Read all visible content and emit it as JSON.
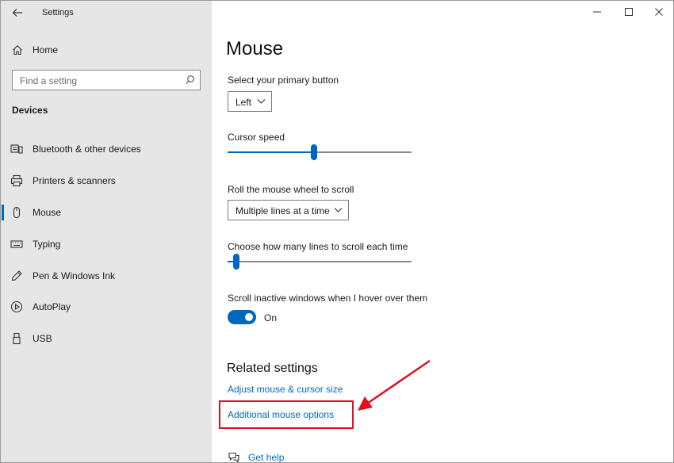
{
  "window": {
    "title": "Settings",
    "controls": [
      "minimize-icon",
      "maximize-icon",
      "close-icon"
    ]
  },
  "sidebar": {
    "home_label": "Home",
    "search_placeholder": "Find a setting",
    "section_title": "Devices",
    "items": [
      {
        "label": "Bluetooth & other devices",
        "icon": "bluetooth-device-icon",
        "selected": false
      },
      {
        "label": "Printers & scanners",
        "icon": "printer-icon",
        "selected": false
      },
      {
        "label": "Mouse",
        "icon": "mouse-icon",
        "selected": true
      },
      {
        "label": "Typing",
        "icon": "keyboard-icon",
        "selected": false
      },
      {
        "label": "Pen & Windows Ink",
        "icon": "pen-icon",
        "selected": false
      },
      {
        "label": "AutoPlay",
        "icon": "autoplay-icon",
        "selected": false
      },
      {
        "label": "USB",
        "icon": "usb-icon",
        "selected": false
      }
    ]
  },
  "main": {
    "title": "Mouse",
    "primary_button": {
      "label": "Select your primary button",
      "value": "Left"
    },
    "cursor_speed": {
      "label": "Cursor speed",
      "level": 0.47
    },
    "scroll_wheel": {
      "label": "Roll the mouse wheel to scroll",
      "value": "Multiple lines at a time"
    },
    "lines_to_scroll": {
      "label": "Choose how many lines to scroll each time",
      "level": 0.03
    },
    "scroll_inactive": {
      "label": "Scroll inactive windows when I hover over them",
      "state": "On",
      "enabled": true
    },
    "related": {
      "title": "Related settings",
      "links": [
        "Adjust mouse & cursor size",
        "Additional mouse options"
      ]
    },
    "help_label": "Get help"
  },
  "colors": {
    "accent": "#0067c0",
    "sidebar_bg": "#e6e6e6",
    "annotation": "#e0101f"
  }
}
